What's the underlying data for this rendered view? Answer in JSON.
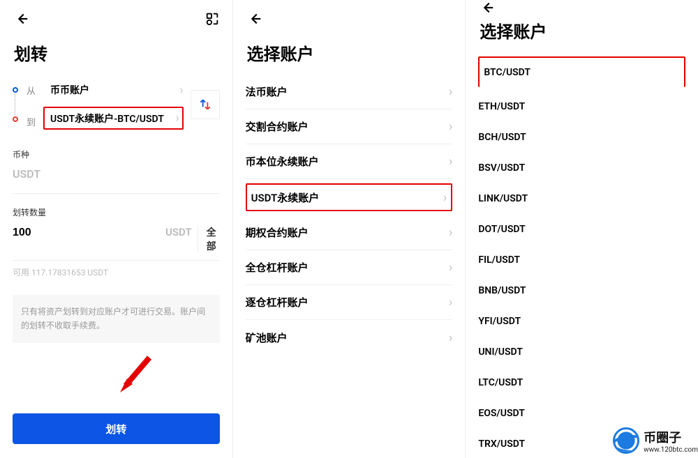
{
  "panel1": {
    "title": "划转",
    "from_label": "从",
    "to_label": "到",
    "from_account": "币币账户",
    "to_account": "USDT永续账户-BTC/USDT",
    "coin_label": "币种",
    "coin": "USDT",
    "qty_label": "划转数量",
    "qty_value": "100",
    "qty_unit": "USDT",
    "max_btn": "全部",
    "available": "可用 117.17831653 USDT",
    "notice": "只有将资产划转到对应账户才可进行交易。账户间的划转不收取手续费。",
    "submit": "划转"
  },
  "panel2": {
    "title": "选择账户",
    "items": [
      {
        "label": "法币账户",
        "highlight": false
      },
      {
        "label": "交割合约账户",
        "highlight": false
      },
      {
        "label": "币本位永续账户",
        "highlight": false
      },
      {
        "label": "USDT永续账户",
        "highlight": true
      },
      {
        "label": "期权合约账户",
        "highlight": false
      },
      {
        "label": "全仓杠杆账户",
        "highlight": false
      },
      {
        "label": "逐仓杠杆账户",
        "highlight": false
      },
      {
        "label": "矿池账户",
        "highlight": false
      }
    ]
  },
  "panel3": {
    "title": "选择账户",
    "items": [
      {
        "label": "BTC/USDT",
        "highlight": true
      },
      {
        "label": "ETH/USDT"
      },
      {
        "label": "BCH/USDT"
      },
      {
        "label": "BSV/USDT"
      },
      {
        "label": "LINK/USDT"
      },
      {
        "label": "DOT/USDT"
      },
      {
        "label": "FIL/USDT"
      },
      {
        "label": "BNB/USDT"
      },
      {
        "label": "YFI/USDT"
      },
      {
        "label": "UNI/USDT"
      },
      {
        "label": "LTC/USDT"
      },
      {
        "label": "EOS/USDT"
      },
      {
        "label": "TRX/USDT"
      }
    ]
  },
  "watermark": {
    "brand": "币圈子",
    "url": "www.120btc.com"
  }
}
